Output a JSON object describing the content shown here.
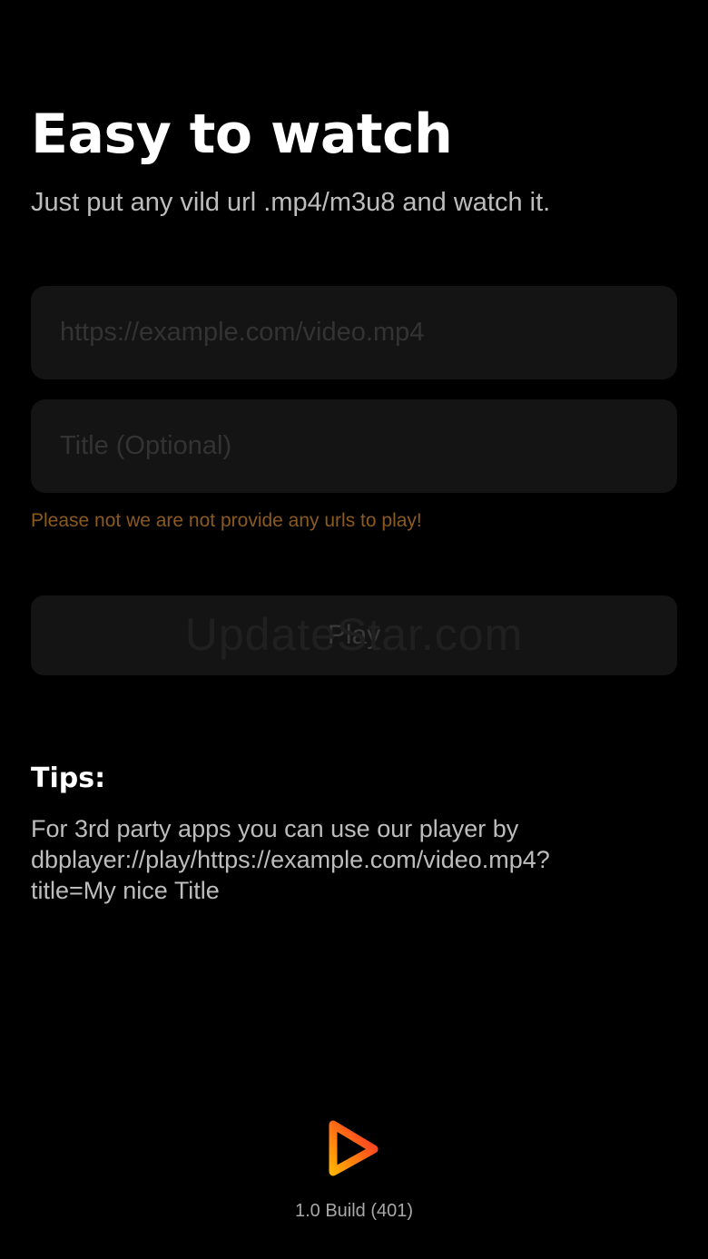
{
  "header": {
    "title": "Easy to watch",
    "subtitle": "Just put any vild url .mp4/m3u8 and watch it."
  },
  "form": {
    "url_value": "",
    "url_placeholder": "https://example.com/video.mp4",
    "title_value": "",
    "title_placeholder": "Title (Optional)",
    "notice": "Please not we are not provide any urls to play!",
    "play_label": "Play",
    "watermark": "UpdateStar.com"
  },
  "tips": {
    "heading": "Tips:",
    "lines": [
      "For 3rd party apps you can use our player by",
      "dbplayer://play/https://example.com/video.mp4?",
      "title=My nice Title"
    ]
  },
  "footer": {
    "logo_icon": "play-triangle-icon",
    "version": "1.0 Build (401)"
  },
  "colors": {
    "background": "#000000",
    "field_background": "#141414",
    "notice": "#8a5a1e",
    "logo_gradient_start": "#ff2a2a",
    "logo_gradient_end": "#ffb000"
  }
}
